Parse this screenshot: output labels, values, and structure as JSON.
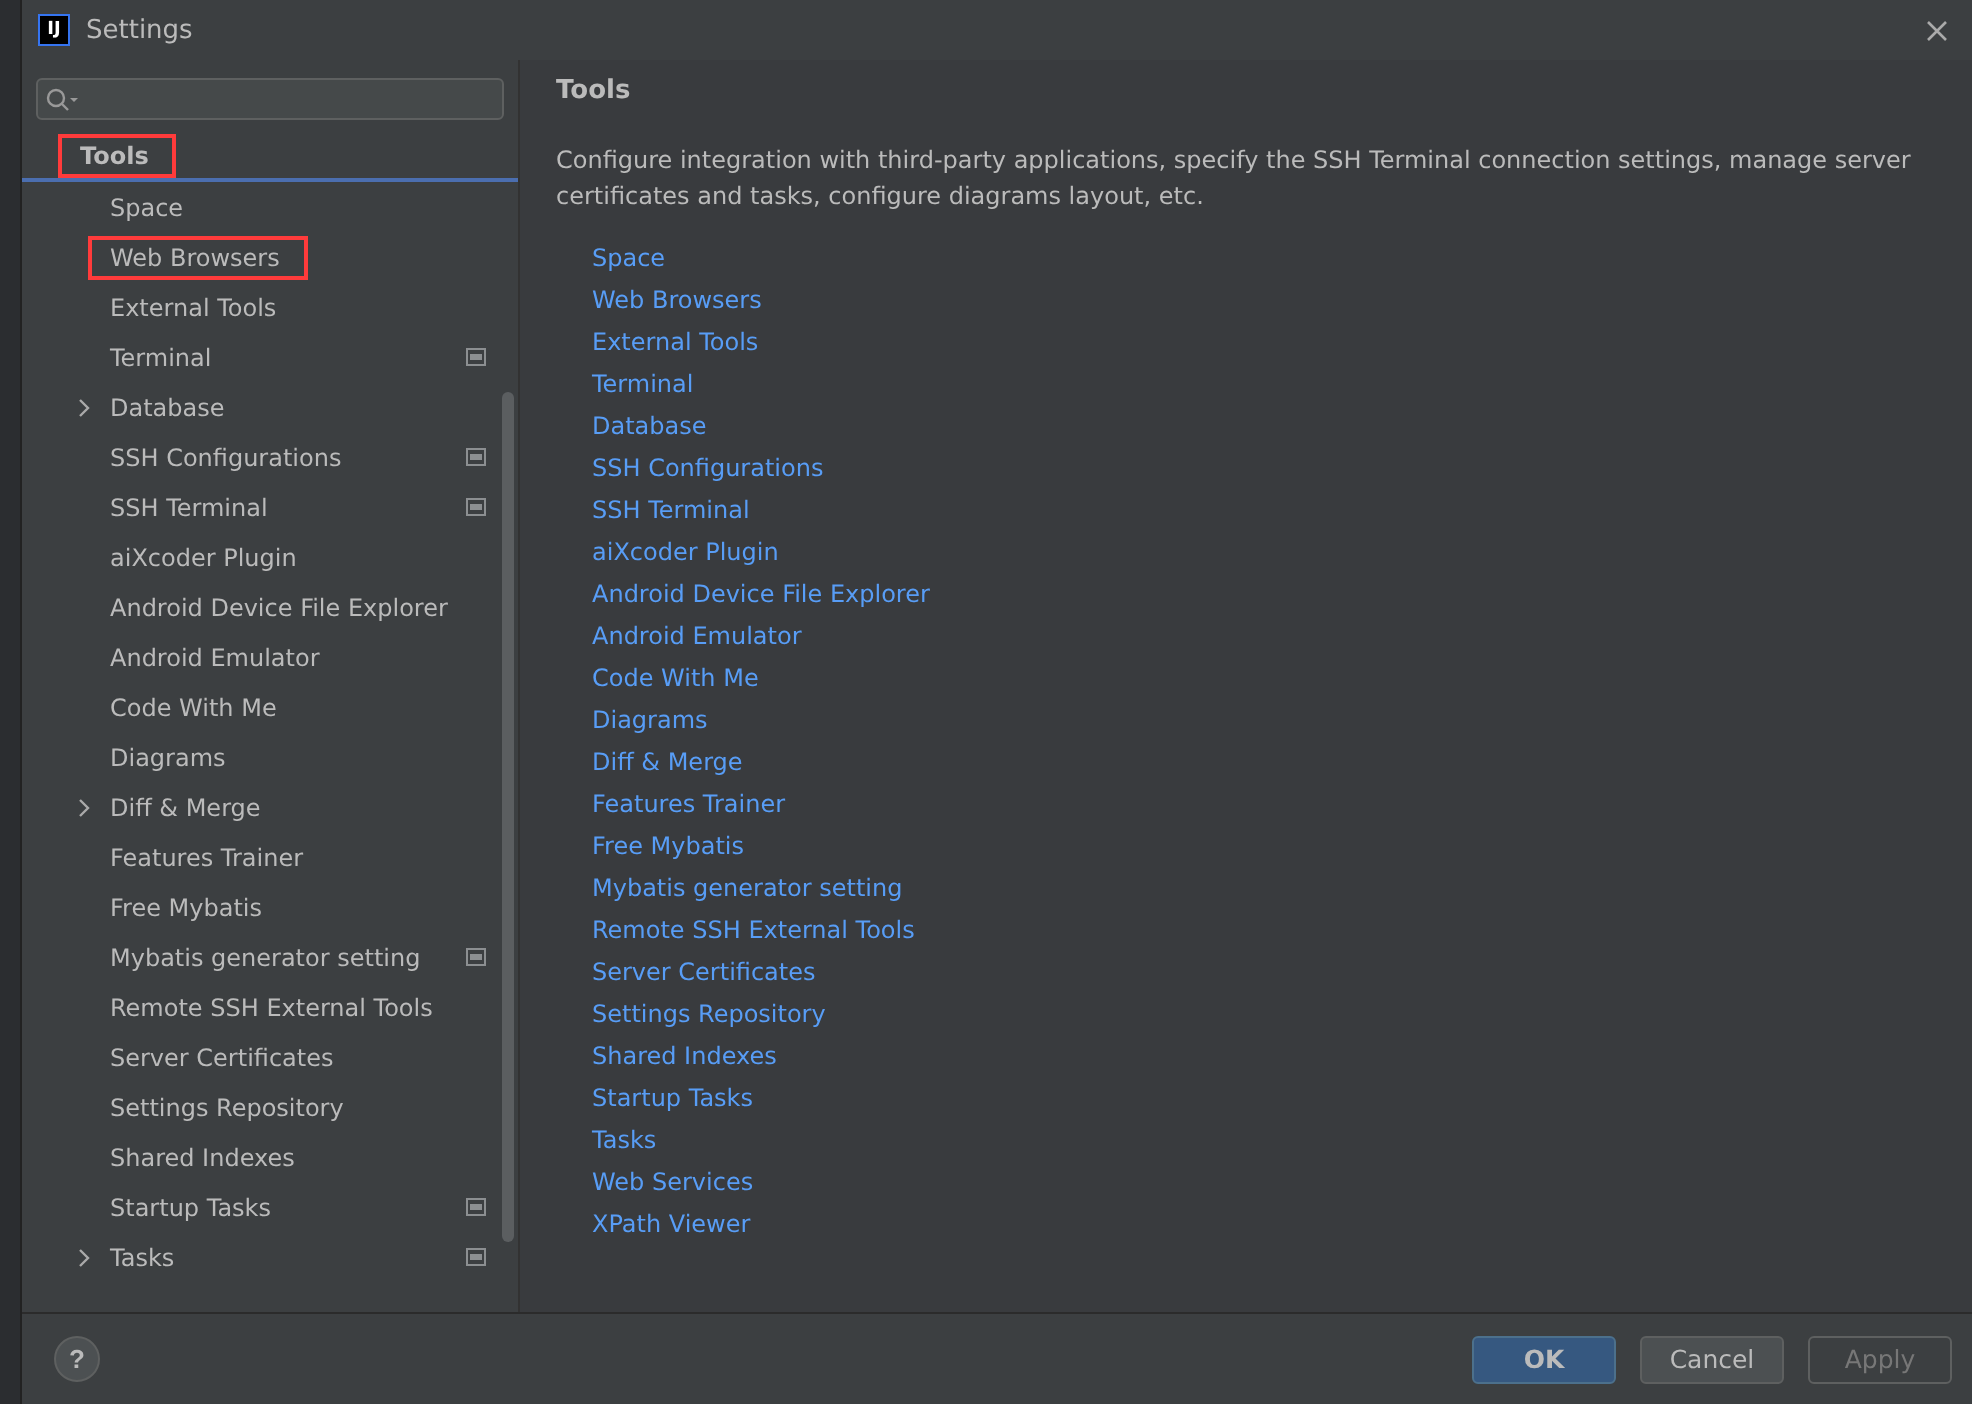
{
  "window": {
    "app_icon": "IJ",
    "title": "Settings"
  },
  "tree": {
    "label": "Tools",
    "selected": true,
    "annotated": true,
    "children": [
      {
        "label": "Space",
        "expandable": false,
        "settings_icon": false,
        "annotated": false,
        "selected": false
      },
      {
        "label": "Web Browsers",
        "expandable": false,
        "settings_icon": false,
        "annotated": true,
        "selected": false
      },
      {
        "label": "External Tools",
        "expandable": false,
        "settings_icon": false,
        "annotated": false,
        "selected": false
      },
      {
        "label": "Terminal",
        "expandable": false,
        "settings_icon": true,
        "annotated": false,
        "selected": false
      },
      {
        "label": "Database",
        "expandable": true,
        "settings_icon": false,
        "annotated": false,
        "selected": false
      },
      {
        "label": "SSH Configurations",
        "expandable": false,
        "settings_icon": true,
        "annotated": false,
        "selected": false
      },
      {
        "label": "SSH Terminal",
        "expandable": false,
        "settings_icon": true,
        "annotated": false,
        "selected": false
      },
      {
        "label": "aiXcoder Plugin",
        "expandable": false,
        "settings_icon": false,
        "annotated": false,
        "selected": false
      },
      {
        "label": "Android Device File Explorer",
        "expandable": false,
        "settings_icon": false,
        "annotated": false,
        "selected": false
      },
      {
        "label": "Android Emulator",
        "expandable": false,
        "settings_icon": false,
        "annotated": false,
        "selected": false
      },
      {
        "label": "Code With Me",
        "expandable": false,
        "settings_icon": false,
        "annotated": false,
        "selected": false
      },
      {
        "label": "Diagrams",
        "expandable": false,
        "settings_icon": false,
        "annotated": false,
        "selected": false
      },
      {
        "label": "Diff & Merge",
        "expandable": true,
        "settings_icon": false,
        "annotated": false,
        "selected": false
      },
      {
        "label": "Features Trainer",
        "expandable": false,
        "settings_icon": false,
        "annotated": false,
        "selected": false
      },
      {
        "label": "Free Mybatis",
        "expandable": false,
        "settings_icon": false,
        "annotated": false,
        "selected": false
      },
      {
        "label": "Mybatis generator setting",
        "expandable": false,
        "settings_icon": true,
        "annotated": false,
        "selected": false
      },
      {
        "label": "Remote SSH External Tools",
        "expandable": false,
        "settings_icon": false,
        "annotated": false,
        "selected": false
      },
      {
        "label": "Server Certificates",
        "expandable": false,
        "settings_icon": false,
        "annotated": false,
        "selected": false
      },
      {
        "label": "Settings Repository",
        "expandable": false,
        "settings_icon": false,
        "annotated": false,
        "selected": false
      },
      {
        "label": "Shared Indexes",
        "expandable": false,
        "settings_icon": false,
        "annotated": false,
        "selected": false
      },
      {
        "label": "Startup Tasks",
        "expandable": false,
        "settings_icon": true,
        "annotated": false,
        "selected": false
      },
      {
        "label": "Tasks",
        "expandable": true,
        "settings_icon": true,
        "annotated": false,
        "selected": false
      }
    ]
  },
  "content": {
    "title": "Tools",
    "description": "Configure integration with third-party applications, specify the SSH Terminal connection settings, manage server certificates and tasks, configure diagrams layout, etc.",
    "links": [
      "Space",
      "Web Browsers",
      "External Tools",
      "Terminal",
      "Database",
      "SSH Configurations",
      "SSH Terminal",
      "aiXcoder Plugin",
      "Android Device File Explorer",
      "Android Emulator",
      "Code With Me",
      "Diagrams",
      "Diff & Merge",
      "Features Trainer",
      "Free Mybatis",
      "Mybatis generator setting",
      "Remote SSH External Tools",
      "Server Certificates",
      "Settings Repository",
      "Shared Indexes",
      "Startup Tasks",
      "Tasks",
      "Web Services",
      "XPath Viewer"
    ]
  },
  "buttons": [
    {
      "label": "OK",
      "default": true,
      "disabled": false
    },
    {
      "label": "Cancel",
      "default": false,
      "disabled": false
    },
    {
      "label": "Apply",
      "default": false,
      "disabled": true
    }
  ],
  "help": {
    "label": "?"
  }
}
